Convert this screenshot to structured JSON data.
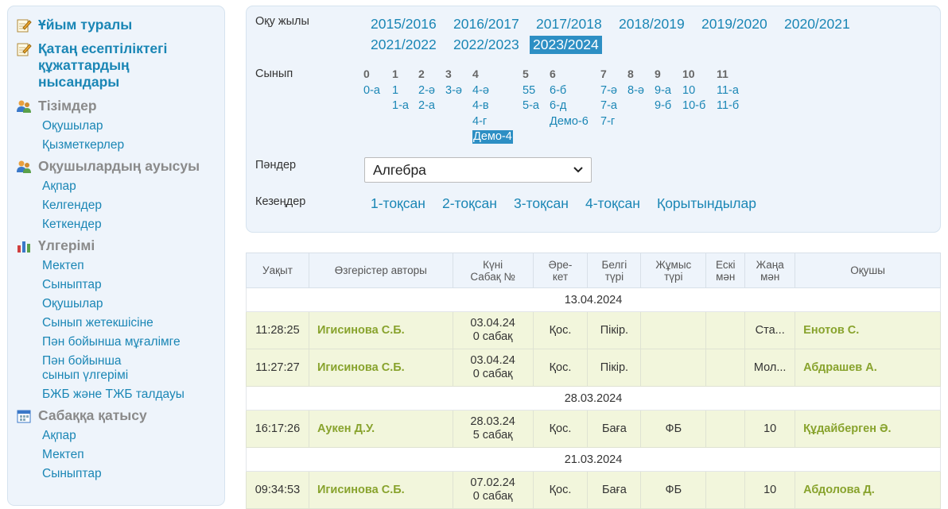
{
  "sidebar": {
    "about": "Ұйым туралы",
    "strict_docs": [
      "Қатаң есептіліктегі",
      "құжаттардың",
      "нысандары"
    ],
    "lists": {
      "title": "Тізімдер",
      "items": [
        "Оқушылар",
        "Қызметкерлер"
      ]
    },
    "transfer": {
      "title": "Оқушылардың ауысуы",
      "items": [
        "Ақпар",
        "Келгендер",
        "Кеткендер"
      ]
    },
    "progress": {
      "title": "Үлгерімі",
      "items": [
        "Мектеп",
        "Сыныптар",
        "Оқушылар",
        "Сынып жетекшісіне",
        "Пән бойынша мұғалімге"
      ],
      "subject_class": [
        "Пән бойынша",
        "сынып үлгерімі"
      ],
      "bzb": "БЖБ және ТЖБ талдауы"
    },
    "attendance": {
      "title": "Сабаққа қатысу",
      "items": [
        "Ақпар",
        "Мектеп",
        "Сыныптар"
      ]
    }
  },
  "filters": {
    "year_label": "Оқу жылы",
    "years": [
      "2015/2016",
      "2016/2017",
      "2017/2018",
      "2018/2019",
      "2019/2020",
      "2020/2021",
      "2021/2022",
      "2022/2023",
      "2023/2024"
    ],
    "selected_year": "2023/2024",
    "class_label": "Сынып",
    "grades": [
      {
        "grade": "0",
        "classes": [
          "0-а"
        ]
      },
      {
        "grade": "1",
        "classes": [
          "1",
          "1-а"
        ]
      },
      {
        "grade": "2",
        "classes": [
          "2-ә",
          "2-а"
        ]
      },
      {
        "grade": "3",
        "classes": [
          "3-ә"
        ]
      },
      {
        "grade": "4",
        "classes": [
          "4-ә",
          "4-в",
          "4-г",
          "Демо-4"
        ]
      },
      {
        "grade": "5",
        "classes": [
          "55",
          "5-а"
        ]
      },
      {
        "grade": "6",
        "classes": [
          "6-б",
          "6-д",
          "Демо-6"
        ]
      },
      {
        "grade": "7",
        "classes": [
          "7-ә",
          "7-а",
          "7-г"
        ]
      },
      {
        "grade": "8",
        "classes": [
          "8-ә"
        ]
      },
      {
        "grade": "9",
        "classes": [
          "9-а",
          "9-б"
        ]
      },
      {
        "grade": "10",
        "classes": [
          "10",
          "10-б"
        ]
      },
      {
        "grade": "11",
        "classes": [
          "11-а",
          "11-б"
        ]
      }
    ],
    "selected_class": "Демо-4",
    "subjects_label": "Пәндер",
    "subject_value": "Алгебра",
    "periods_label": "Кезеңдер",
    "periods": [
      "1-тоқсан",
      "2-тоқсан",
      "3-тоқсан",
      "4-тоқсан",
      "Қорытындылар"
    ]
  },
  "table": {
    "headers": {
      "time": "Уақыт",
      "author": "Өзгерістер авторы",
      "date_lesson": [
        "Күні",
        "Сабақ №"
      ],
      "action": [
        "Әре-",
        "кет"
      ],
      "mark_type": [
        "Белгі",
        "түрі"
      ],
      "work_type": [
        "Жұмыс",
        "түрі"
      ],
      "old_val": [
        "Ескі",
        "мән"
      ],
      "new_val": [
        "Жаңа",
        "мән"
      ],
      "student": "Оқушы"
    },
    "groups": [
      {
        "date": "13.04.2024",
        "rows": [
          {
            "time": "11:28:25",
            "author": "Игисинова С.Б.",
            "date": "03.04.24",
            "lesson": "0 сабақ",
            "action": "Қос.",
            "mark_type": "Пікір.",
            "work_type": "",
            "old": "",
            "new": "Ста...",
            "student": "Енотов С."
          },
          {
            "time": "11:27:27",
            "author": "Игисинова С.Б.",
            "date": "03.04.24",
            "lesson": "0 сабақ",
            "action": "Қос.",
            "mark_type": "Пікір.",
            "work_type": "",
            "old": "",
            "new": "Мол...",
            "student": "Абдрашев А."
          }
        ]
      },
      {
        "date": "28.03.2024",
        "rows": [
          {
            "time": "16:17:26",
            "author": "Аукен Д.У.",
            "date": "28.03.24",
            "lesson": "5 сабақ",
            "action": "Қос.",
            "mark_type": "Баға",
            "work_type": "ФБ",
            "old": "",
            "new": "10",
            "student": "Құдайберген Ә."
          }
        ]
      },
      {
        "date": "21.03.2024",
        "rows": [
          {
            "time": "09:34:53",
            "author": "Игисинова С.Б.",
            "date": "07.02.24",
            "lesson": "0 сабақ",
            "action": "Қос.",
            "mark_type": "Баға",
            "work_type": "ФБ",
            "old": "",
            "new": "10",
            "student": "Абдолова Д."
          }
        ]
      }
    ]
  }
}
